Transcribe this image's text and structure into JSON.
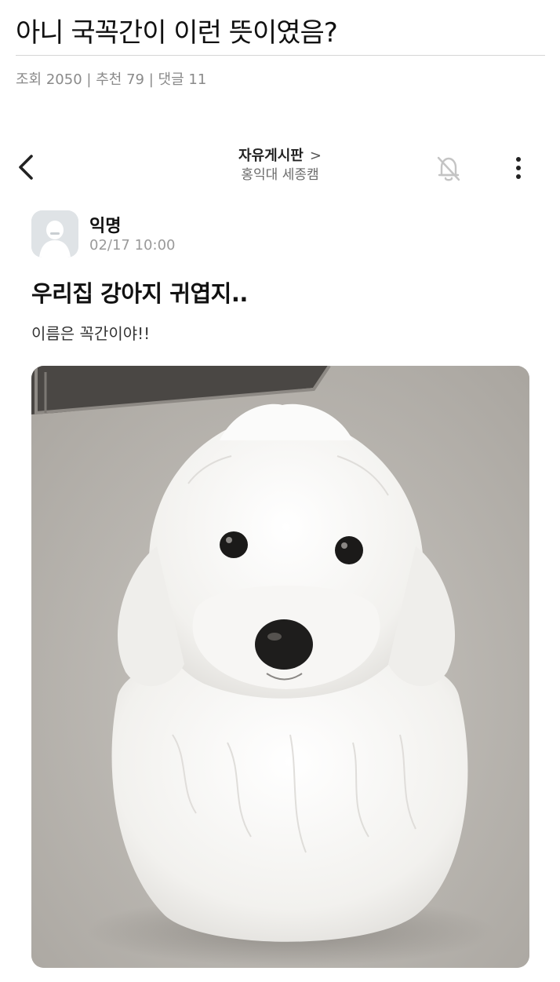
{
  "post": {
    "title": "아니 국꼭간이 이런 뜻이였음?",
    "meta": {
      "views_label": "조회",
      "views": "2050",
      "likes_label": "추천",
      "likes": "79",
      "comments_label": "댓글",
      "comments": "11",
      "separator": "|"
    }
  },
  "screenshot": {
    "app_bar": {
      "board": "자유게시판",
      "board_chevron": ">",
      "school": "홍익대 세종캠",
      "icons": [
        "back-arrow-icon",
        "bell-off-icon",
        "more-vertical-icon"
      ]
    },
    "author": {
      "name": "익명",
      "time": "02/17 10:00"
    },
    "title": "우리집 강아지 귀엽지..",
    "body": "이름은 꼭간이야!!",
    "photo": {
      "subject": "fluffy-white-dog"
    }
  },
  "colors": {
    "text": "#111111",
    "meta": "#8a8a8a",
    "divider": "#d6d6d6",
    "avatar_bg": "#dfe3e6",
    "floor": "#b9b6b1",
    "dog_fur": "#f4f3f1"
  }
}
